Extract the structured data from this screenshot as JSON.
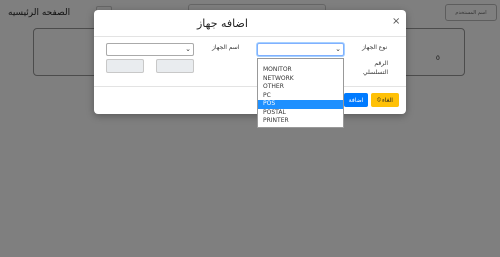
{
  "background": {
    "page_title": "الصفحه الرئيسيه",
    "user_button": "اسم المستخدم",
    "card_value": "0"
  },
  "modal": {
    "title": "اضافه جهاز",
    "close_icon": "×",
    "labels": {
      "device_type": "نوع الجهاز",
      "device_name": "اسم الجهاز",
      "serial_number": "الرقم التسلسلي"
    },
    "buttons": {
      "cancel": "الغاء",
      "add": "اضافة"
    }
  },
  "dropdown": {
    "selected": "POS",
    "options": [
      "MONITOR",
      "NETWORK",
      "OTHER",
      "PC",
      "POS",
      "POSTAL",
      "PRINTER"
    ]
  },
  "colors": {
    "primary": "#007bff",
    "warning": "#ffc107",
    "selected_option": "#1e90ff"
  }
}
